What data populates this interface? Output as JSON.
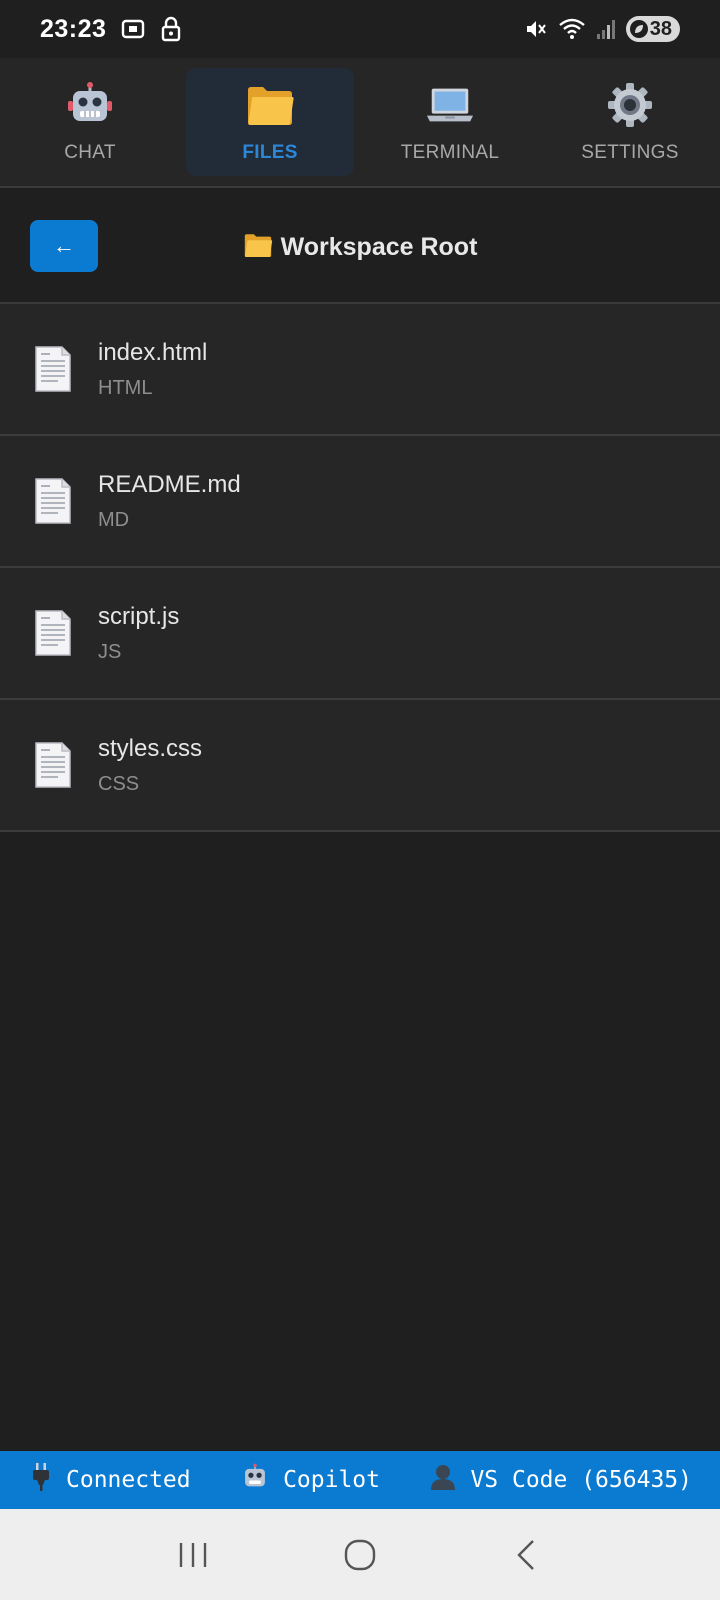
{
  "status_bar": {
    "time": "23:23",
    "battery_level": "38",
    "icons": [
      "screenshot-icon",
      "lock-icon",
      "mute-icon",
      "wifi-icon",
      "signal-icon",
      "battery-icon"
    ]
  },
  "tabs": [
    {
      "label": "CHAT",
      "icon": "robot-icon",
      "active": false
    },
    {
      "label": "FILES",
      "icon": "folder-icon",
      "active": true
    },
    {
      "label": "TERMINAL",
      "icon": "laptop-icon",
      "active": false
    },
    {
      "label": "SETTINGS",
      "icon": "gear-icon",
      "active": false
    }
  ],
  "path_header": {
    "back_label": "←",
    "title": "Workspace Root",
    "title_icon": "folder-icon"
  },
  "files": [
    {
      "name": "index.html",
      "type": "HTML",
      "icon": "document-icon"
    },
    {
      "name": "README.md",
      "type": "MD",
      "icon": "document-icon"
    },
    {
      "name": "script.js",
      "type": "JS",
      "icon": "document-icon"
    },
    {
      "name": "styles.css",
      "type": "CSS",
      "icon": "document-icon"
    }
  ],
  "footer": {
    "connection": "Connected",
    "agent": "Copilot",
    "client": "VS Code (656435)"
  },
  "colors": {
    "accent": "#0b7ad1",
    "active_tab_text": "#2e86d6",
    "background": "#1f1f1f"
  }
}
